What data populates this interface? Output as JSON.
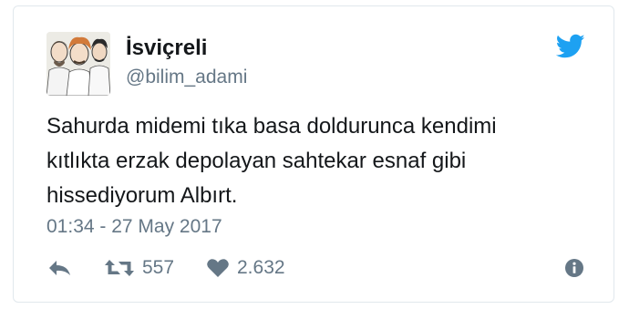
{
  "tweet": {
    "display_name": "İsviçreli",
    "handle": "@bilim_adami",
    "text_lines": [
      "Sahurda midemi tıka basa doldurunca kendimi",
      "kıtlıkta erzak depolayan sahtekar esnaf gibi",
      "hissediyorum Albırt."
    ],
    "timestamp": "01:34 - 27 May 2017"
  },
  "actions": {
    "retweet_count": "557",
    "like_count": "2.632"
  },
  "icons": [
    "twitter-bird-icon",
    "reply-icon",
    "retweet-icon",
    "heart-icon",
    "info-icon"
  ],
  "colors": {
    "brand_blue": "#1da1f2",
    "icon_gray": "#657786",
    "text_dark": "#14171a",
    "border": "#e1e8ed"
  }
}
